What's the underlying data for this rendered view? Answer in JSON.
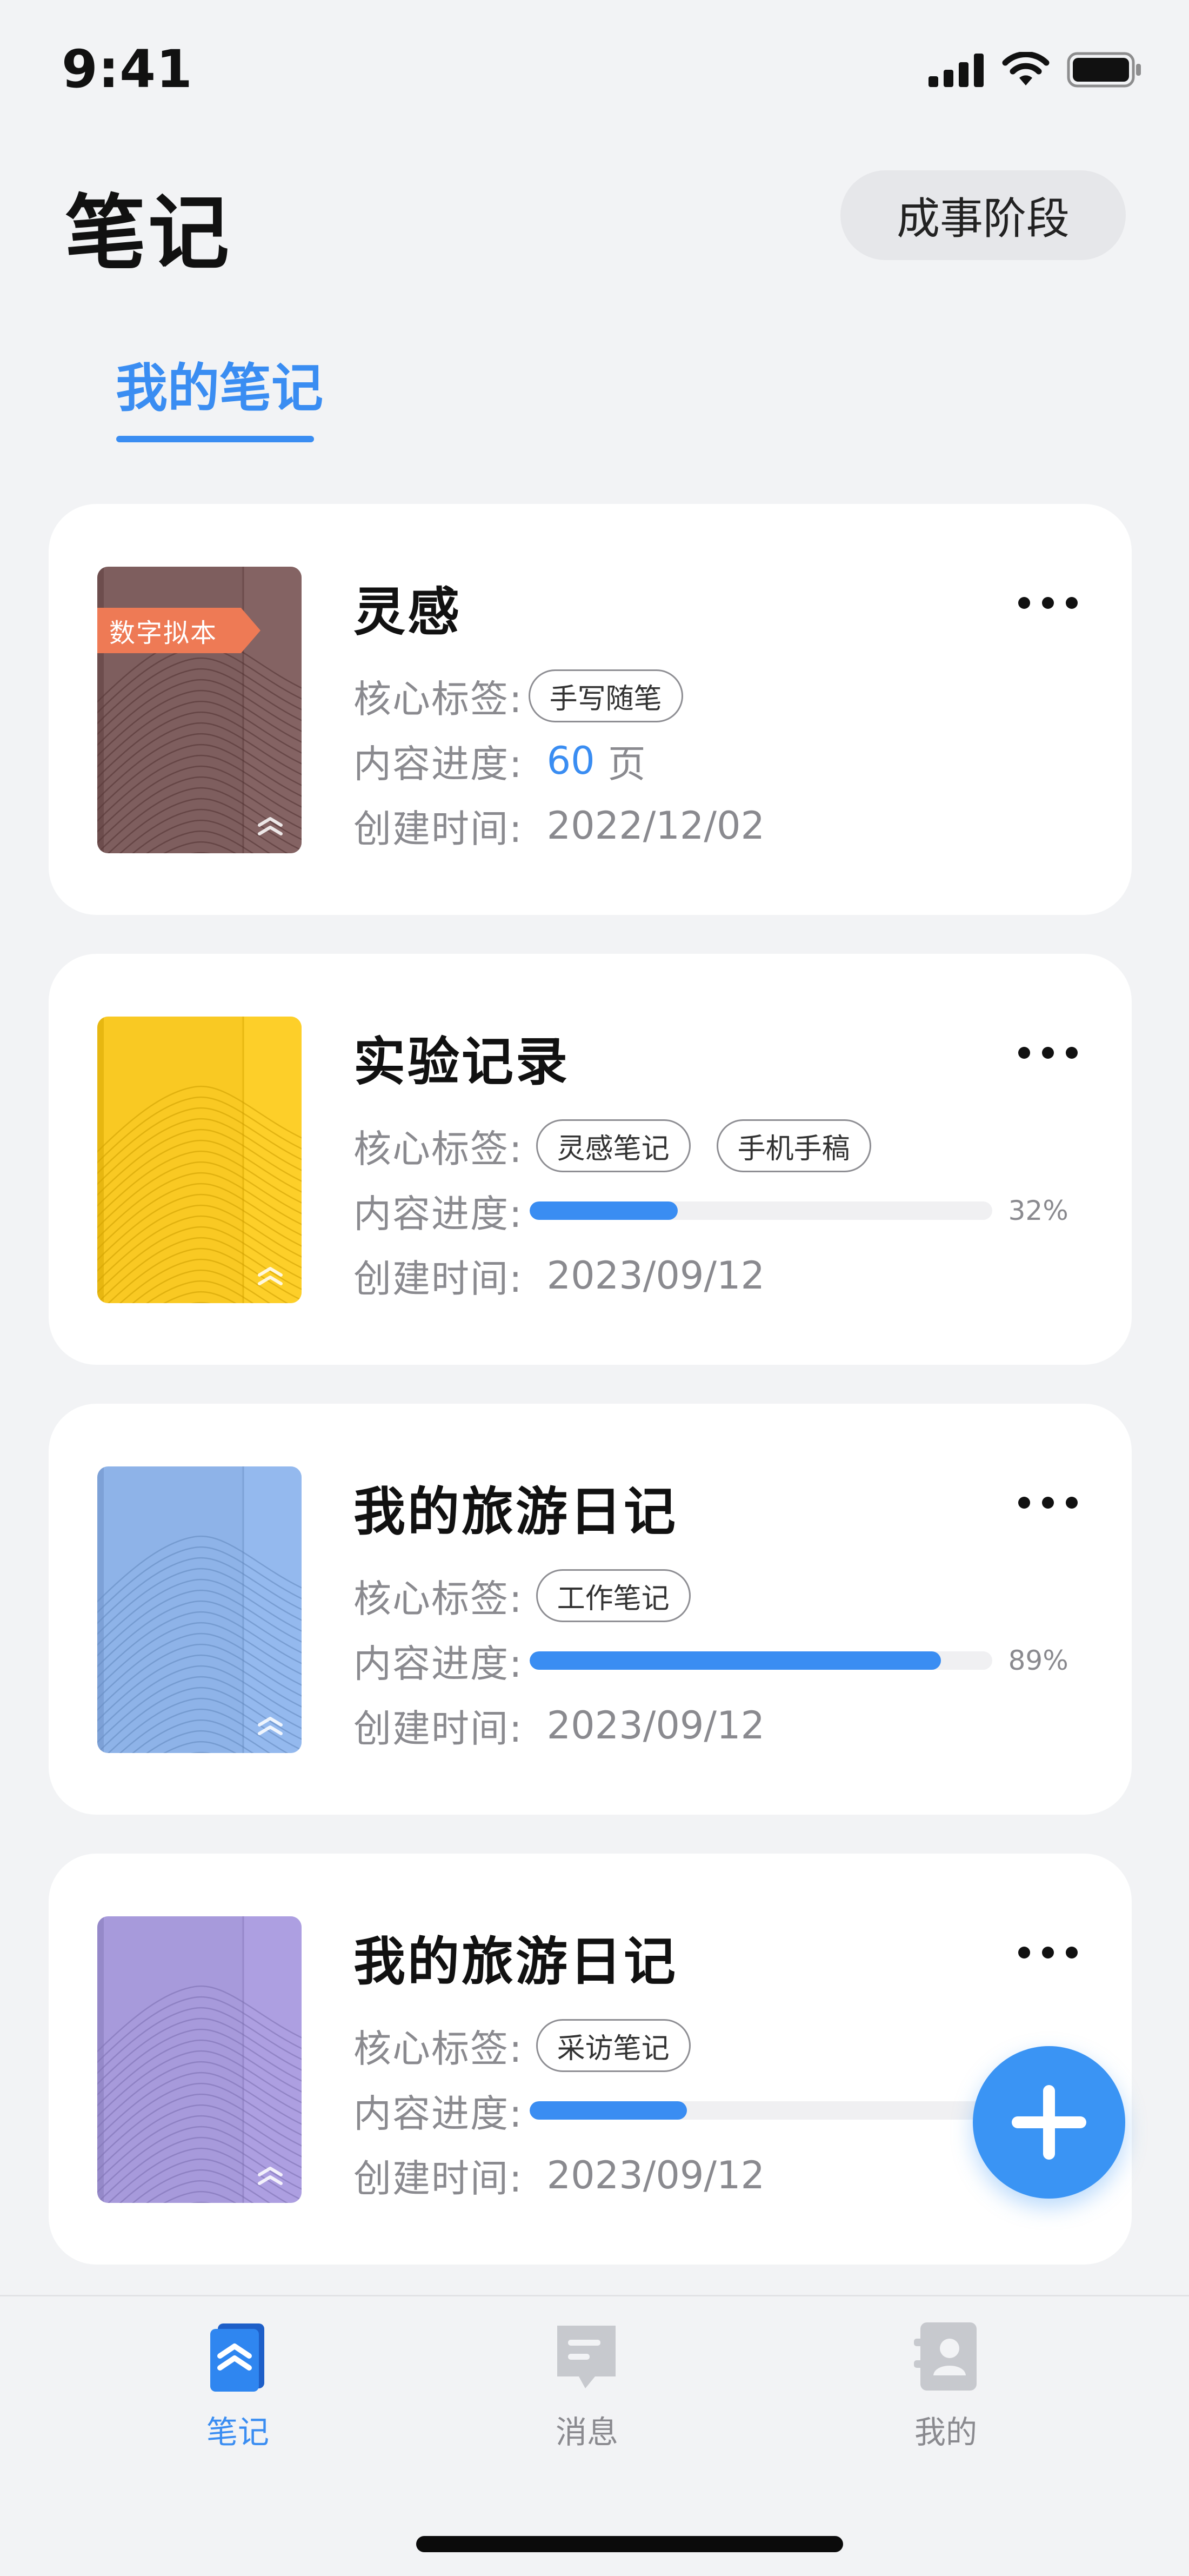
{
  "status_bar": {
    "time": "9:41"
  },
  "header": {
    "title": "笔记",
    "stage_button_label": "成事阶段"
  },
  "tabs": [
    {
      "label": "我的笔记",
      "active": true
    }
  ],
  "labels": {
    "core_tags": "核心标签:",
    "content_progress": "内容进度:",
    "created_time": "创建时间:"
  },
  "notes": [
    {
      "title": "灵感",
      "cover_color": "#7E5E5E",
      "cover_badge": "数字拟本",
      "tags": [
        "手写随笔"
      ],
      "progress_pages": "60",
      "progress_unit": "页",
      "created": "2022/12/02"
    },
    {
      "title": "实验记录",
      "cover_color": "#F9C923",
      "tags": [
        "灵感笔记",
        "手机手稿"
      ],
      "progress_percent": 32,
      "progress_label": "32%",
      "created": "2023/09/12"
    },
    {
      "title": "我的旅游日记",
      "cover_color": "#8EB3E8",
      "tags": [
        "工作笔记"
      ],
      "progress_percent": 89,
      "progress_label": "89%",
      "created": "2023/09/12"
    },
    {
      "title": "我的旅游日记",
      "cover_color": "#A79ADB",
      "tags": [
        "采访笔记"
      ],
      "progress_percent": 34,
      "created": "2023/09/12"
    }
  ],
  "fab": {
    "icon": "plus-icon"
  },
  "tab_bar": [
    {
      "label": "笔记",
      "icon": "notes-icon",
      "active": true
    },
    {
      "label": "消息",
      "icon": "message-icon",
      "active": false
    },
    {
      "label": "我的",
      "icon": "profile-icon",
      "active": false
    }
  ],
  "colors": {
    "accent": "#3A8DF2",
    "background": "#F2F3F5"
  }
}
